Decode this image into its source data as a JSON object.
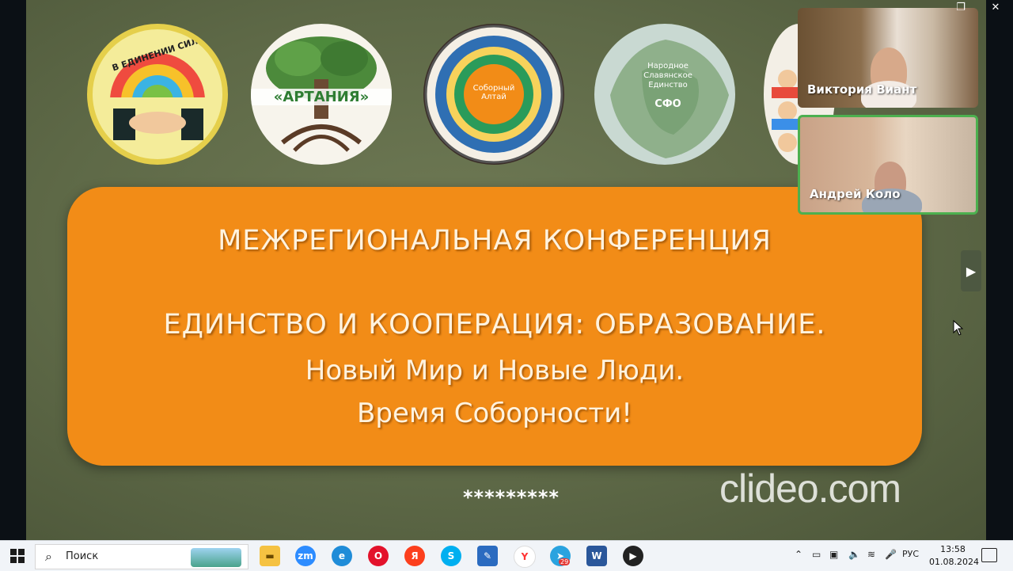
{
  "logos": {
    "logo1_text": "В ЕДИНЕНИИ СИЛА",
    "logo2_text": "«АРТАНИЯ»",
    "logo3_text": "Соборный Алтай",
    "logo4_line1": "Народное",
    "logo4_line2": "Славянское",
    "logo4_line3": "Единство",
    "logo4_abbr": "СФО"
  },
  "banner": {
    "line1": "МЕЖРЕГИОНАЛЬНАЯ КОНФЕРЕНЦИЯ",
    "line2": "ЕДИНСТВО И КООПЕРАЦИЯ: ОБРАЗОВАНИЕ.",
    "line3": "Новый Мир и Новые Люди.",
    "line4": "Время Соборности!"
  },
  "stars": "*********",
  "watermark": "clideo.com",
  "participants": [
    {
      "name": "Виктория  Виант"
    },
    {
      "name": "Андрей Коло"
    }
  ],
  "taskbar": {
    "search_placeholder": "Поиск",
    "apps": [
      {
        "icon": "file-explorer-icon",
        "label": ""
      },
      {
        "icon": "zoom-icon",
        "label": "zm"
      },
      {
        "icon": "edge-icon",
        "label": ""
      },
      {
        "icon": "opera-icon",
        "label": "O"
      },
      {
        "icon": "yandex-icon",
        "label": "Я"
      },
      {
        "icon": "skype-icon",
        "label": "S"
      },
      {
        "icon": "editor-icon",
        "label": ""
      },
      {
        "icon": "yandex-browser-icon",
        "label": "Y"
      },
      {
        "icon": "telegram-icon",
        "label": "",
        "badge": "29"
      },
      {
        "icon": "word-icon",
        "label": "W"
      },
      {
        "icon": "media-player-icon",
        "label": ""
      }
    ],
    "language": "РУС",
    "time": "13:58",
    "date": "01.08.2024"
  },
  "colors": {
    "banner": "#f28c17",
    "slide_bg": "#66704c",
    "taskbar": "#f1f4f8",
    "active_speaker_border": "#4cb04f"
  }
}
